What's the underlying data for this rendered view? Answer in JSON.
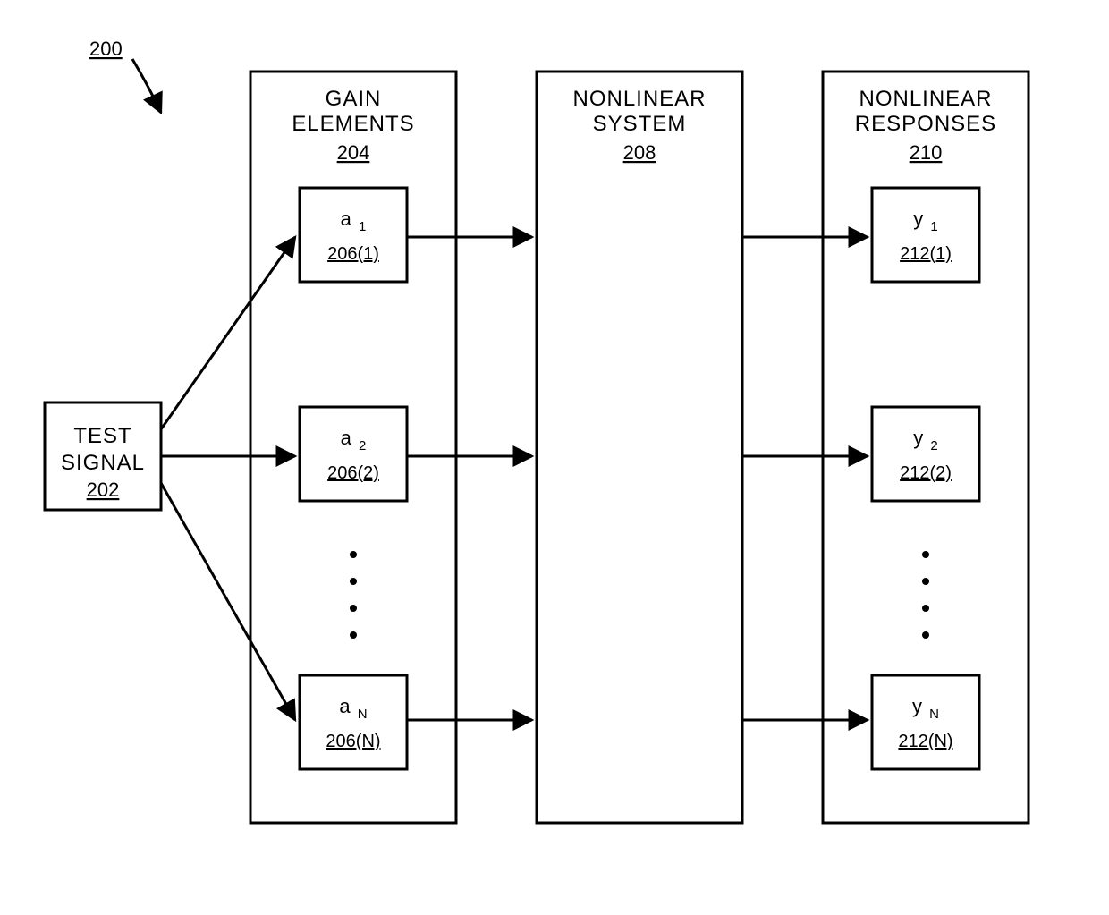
{
  "figure_ref": "200",
  "test_signal": {
    "label": "TEST SIGNAL",
    "ref": "202"
  },
  "gain_block": {
    "title": "GAIN ELEMENTS",
    "ref": "204",
    "items": [
      {
        "sym": "a",
        "sub": "1",
        "ref": "206(1)"
      },
      {
        "sym": "a",
        "sub": "2",
        "ref": "206(2)"
      },
      {
        "sym": "a",
        "sub": "N",
        "ref": "206(N)"
      }
    ]
  },
  "system_block": {
    "title": "NONLINEAR SYSTEM",
    "ref": "208"
  },
  "response_block": {
    "title": "NONLINEAR RESPONSES",
    "ref": "210",
    "items": [
      {
        "sym": "y",
        "sub": "1",
        "ref": "212(1)"
      },
      {
        "sym": "y",
        "sub": "2",
        "ref": "212(2)"
      },
      {
        "sym": "y",
        "sub": "N",
        "ref": "212(N)"
      }
    ]
  }
}
